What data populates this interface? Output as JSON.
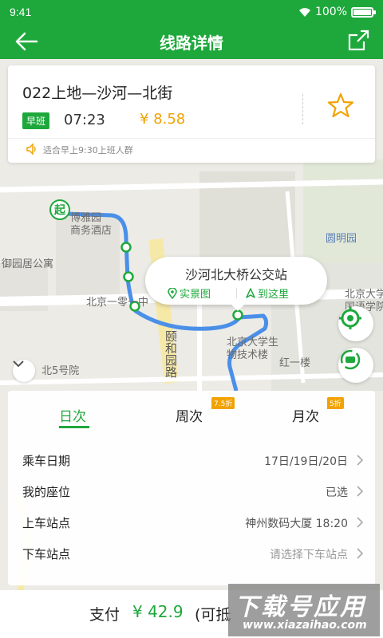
{
  "status_bar": {
    "time": "9:41",
    "battery": "100%"
  },
  "nav": {
    "title": "线路详情",
    "back_icon": "back-arrow-icon",
    "share_icon": "share-icon"
  },
  "route": {
    "name": "022上地—沙河—北街",
    "tag": "早班",
    "time": "07:23",
    "price": "¥ 8.58",
    "tip": "适合早上9:30上班人群"
  },
  "map": {
    "labels": {
      "hotel_1": "博雅园",
      "hotel_2": "商务酒店",
      "house": "御园居公寓",
      "road": "北京一零一中",
      "road2": "颐和园路",
      "garden": "圆明园",
      "pku_lang": "北京大学",
      "pku_lang2": "国语学院",
      "pku_tech": "北京大学生",
      "pku_tech2": "物技术楼",
      "red": "红一楼",
      "bei5": "北5号院",
      "start_marker": "起"
    },
    "popup": {
      "stop_name": "沙河北大桥公交站",
      "action_photo": "实景图",
      "action_go": "到这里"
    }
  },
  "tabs": [
    {
      "label": "日次",
      "discount": ""
    },
    {
      "label": "周次",
      "discount": "7.5折"
    },
    {
      "label": "月次",
      "discount": "5折"
    }
  ],
  "booking": {
    "rows": [
      {
        "label": "乘车日期",
        "value": "17日/19日/20日"
      },
      {
        "label": "我的座位",
        "value": "已选"
      },
      {
        "label": "上车站点",
        "value": "神州数码大厦 18:20"
      },
      {
        "label": "下车站点",
        "value": "请选择下车站点"
      }
    ]
  },
  "pay": {
    "label": "支付",
    "amount": "¥ 42.9",
    "note": "(可抵"
  },
  "watermark": {
    "line1": "下载号应用",
    "line2": "www.xiazaihao.com"
  },
  "colors": {
    "primary": "#1ea83c",
    "price": "#f2a200",
    "route_line": "#4a8fe8"
  }
}
